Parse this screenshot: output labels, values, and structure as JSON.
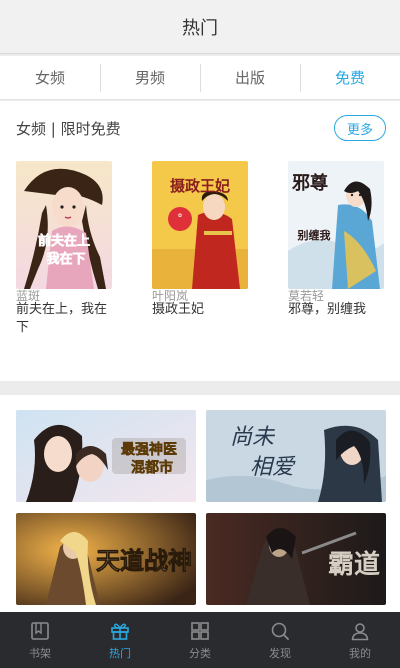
{
  "header": {
    "title": "热门"
  },
  "tabs": [
    {
      "label": "女频"
    },
    {
      "label": "男频"
    },
    {
      "label": "出版"
    },
    {
      "label": "免费",
      "active": true
    }
  ],
  "section": {
    "title": "女频 | 限时免费",
    "more_label": "更多",
    "books": [
      {
        "title": "前夫在上，我在下",
        "author": "蓝斑",
        "cover_text": [
          "前夫在上",
          "我在下"
        ],
        "cover_icon": "cover-girl-with-hat"
      },
      {
        "title": "摄政王妃",
        "author": "叶阳岚",
        "cover_text": [
          "摄政王妃"
        ],
        "cover_icon": "cover-red-dress-woman"
      },
      {
        "title": "邪尊，别缠我",
        "author": "莫若轻",
        "cover_text": [
          "邪尊",
          "别缠我"
        ],
        "cover_icon": "cover-ancient-lady"
      }
    ]
  },
  "banners": [
    {
      "text": "最强神医混都市",
      "icon": "banner-couple-art"
    },
    {
      "text": "尚未相爱",
      "icon": "banner-swordsman-art"
    },
    {
      "text": "天道战神",
      "icon": "banner-warrior-art"
    },
    {
      "text": "霸道",
      "icon": "banner-dark-warrior-art"
    }
  ],
  "tabbar": [
    {
      "label": "书架",
      "icon": "bookshelf-icon"
    },
    {
      "label": "热门",
      "icon": "gift-icon",
      "active": true
    },
    {
      "label": "分类",
      "icon": "grid-icon"
    },
    {
      "label": "发现",
      "icon": "search-icon"
    },
    {
      "label": "我的",
      "icon": "user-icon"
    }
  ],
  "colors": {
    "accent": "#2aa8e0",
    "tabbar_bg": "#2a2b2f"
  }
}
